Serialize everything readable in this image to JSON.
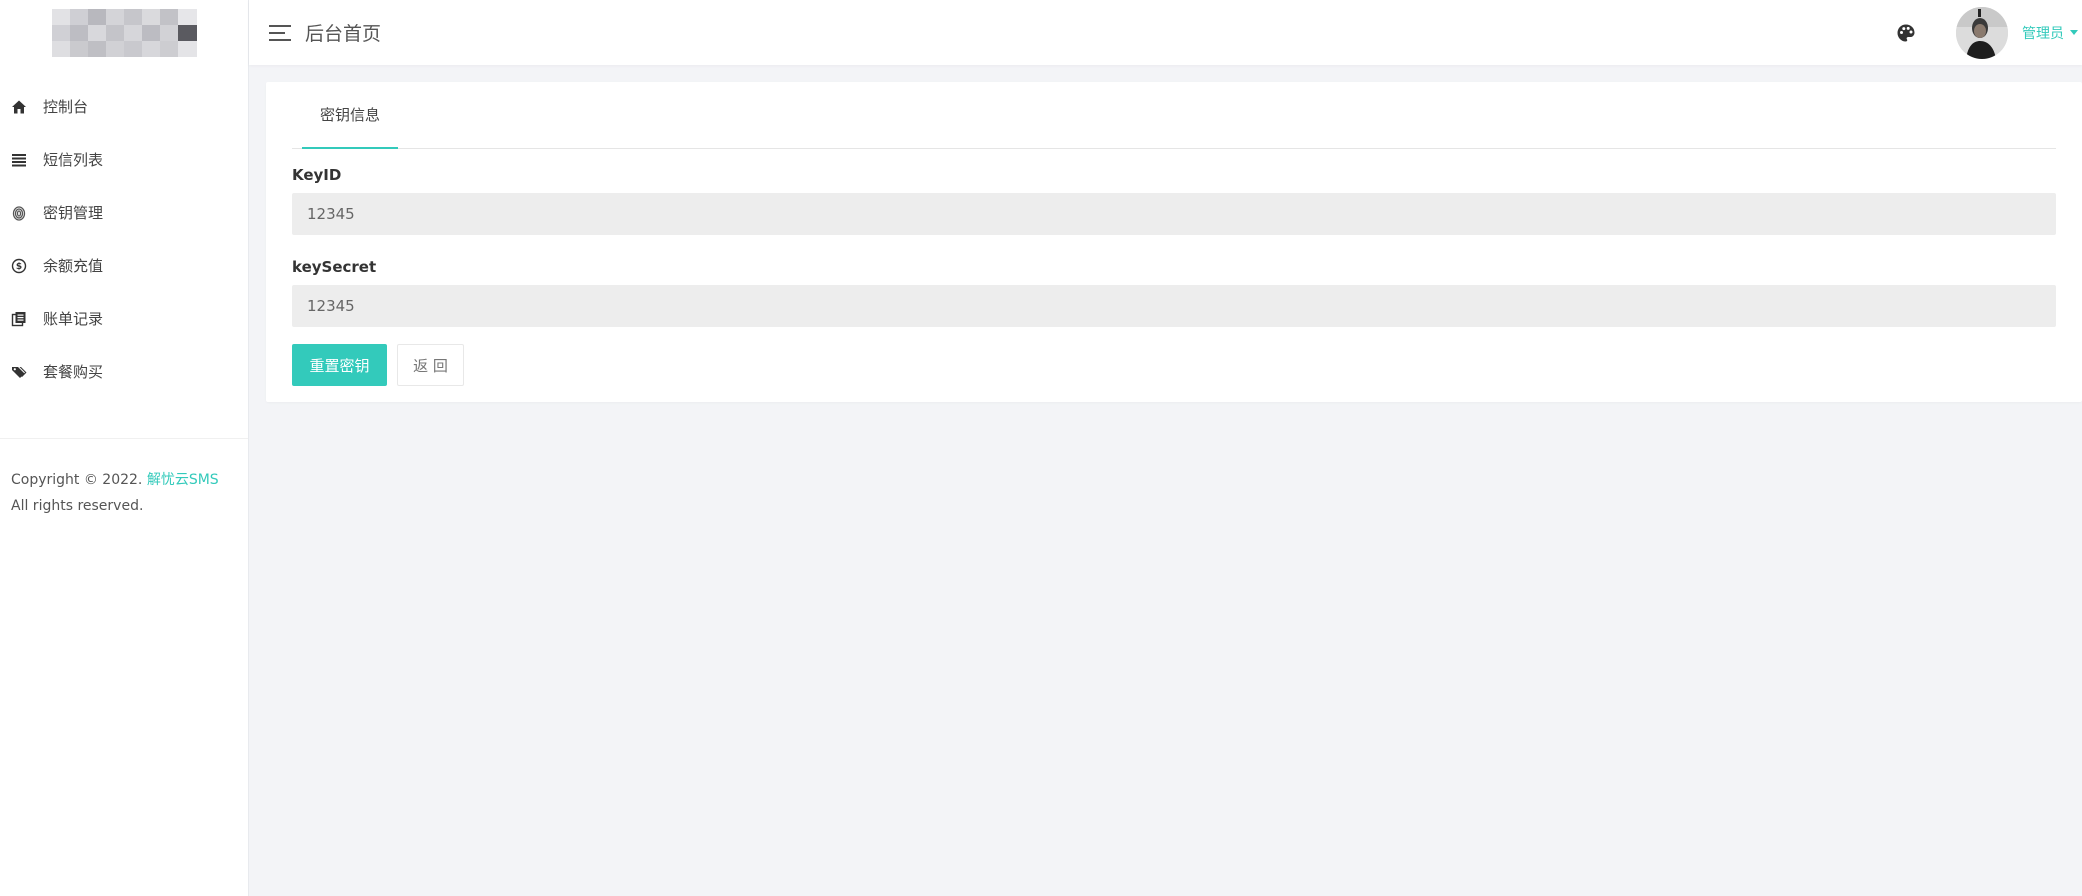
{
  "app": {
    "page_title": "后台首页",
    "accent_color": "#33cabb"
  },
  "sidebar": {
    "logo": "pixelated-logo",
    "items": [
      {
        "label": "控制台",
        "icon": "home-icon"
      },
      {
        "label": "短信列表",
        "icon": "list-icon"
      },
      {
        "label": "密钥管理",
        "icon": "fingerprint-icon"
      },
      {
        "label": "余额充值",
        "icon": "dollar-icon"
      },
      {
        "label": "账单记录",
        "icon": "copy-icon"
      },
      {
        "label": "套餐购买",
        "icon": "tags-icon"
      }
    ],
    "copyright_prefix": "Copyright © 2022. ",
    "copyright_brand": "解忧云SMS",
    "copyright_suffix": "All rights reserved."
  },
  "header": {
    "menu_icon": "hamburger-icon",
    "theme_icon": "palette-icon",
    "user_name": "管理员"
  },
  "main": {
    "tab_label": "密钥信息",
    "fields": [
      {
        "label": "KeyID",
        "value": "12345"
      },
      {
        "label": "keySecret",
        "value": "12345"
      }
    ],
    "reset_button": "重置密钥",
    "back_button": "返 回"
  }
}
